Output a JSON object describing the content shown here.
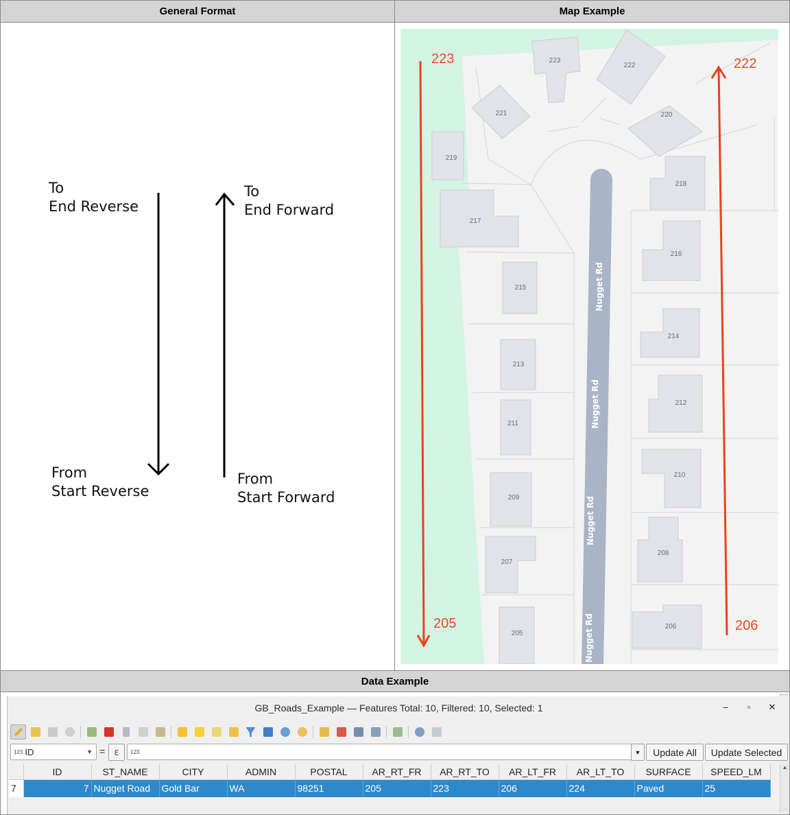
{
  "headers": {
    "general": "General Format",
    "map": "Map Example",
    "data": "Data Example"
  },
  "general_format": {
    "end_reverse": "To\nEnd Reverse",
    "end_forward": "To\nEnd Forward",
    "start_reverse": "From\nStart Reverse",
    "start_forward": "From\nStart Forward"
  },
  "map": {
    "arrow_labels": {
      "left_top": "223",
      "left_bottom": "205",
      "right_top": "222",
      "right_bottom": "206"
    },
    "road_label": "Nugget Rd",
    "parcels": [
      "223",
      "222",
      "221",
      "220",
      "219",
      "218",
      "217",
      "216",
      "215",
      "214",
      "213",
      "212",
      "211",
      "210",
      "209",
      "208",
      "207",
      "206",
      "205"
    ],
    "colors": {
      "arrow": "#e8421c",
      "road": "#a9b4c6",
      "park": "#d3f4e3",
      "building": "#e2e3e8",
      "background": "#f3f3f3"
    }
  },
  "qgis": {
    "title": "GB_Roads_Example — Features Total: 10, Filtered: 10, Selected: 1",
    "window_buttons": {
      "minimize": "–",
      "maximize": "▫",
      "close": "✕"
    },
    "field_selector": "ID",
    "field_type_badge": "123",
    "equals": "=",
    "expression_icon": "ε",
    "value_badge": "123",
    "update_all": "Update All",
    "update_selected": "Update Selected",
    "columns": [
      "ID",
      "ST_NAME",
      "CITY",
      "ADMIN",
      "POSTAL",
      "AR_RT_FR",
      "AR_RT_TO",
      "AR_LT_FR",
      "AR_LT_TO",
      "SURFACE",
      "SPEED_LM"
    ],
    "rows": [
      {
        "rownum": "7",
        "cells": [
          "7",
          "Nugget Road",
          "Gold Bar",
          "WA",
          "98251",
          "205",
          "223",
          "206",
          "224",
          "Paved",
          "25"
        ]
      }
    ],
    "selection_color": "#2f89c9"
  }
}
